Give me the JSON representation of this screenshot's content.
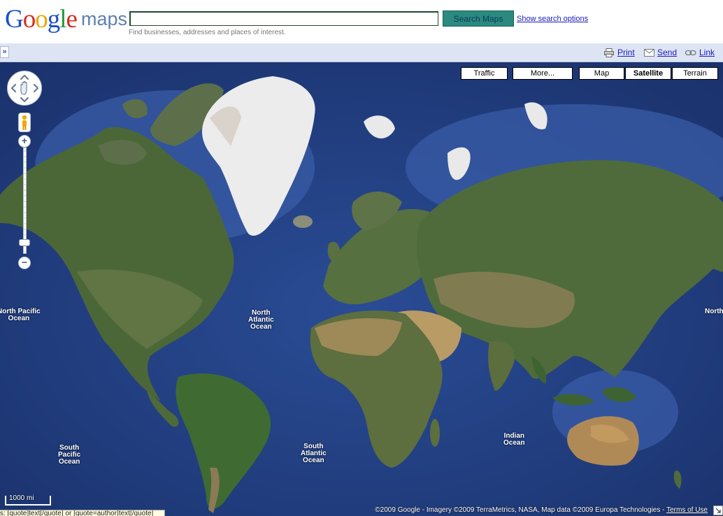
{
  "header": {
    "logo_google": "Google",
    "logo_maps": "maps",
    "search_value": "",
    "search_button": "Search Maps",
    "search_options": "Show search options",
    "search_hint": "Find businesses, addresses and places of interest."
  },
  "toolbar": {
    "expand": "»",
    "print": "Print",
    "send": "Send",
    "link": "Link"
  },
  "map": {
    "types": {
      "traffic": "Traffic",
      "more": "More...",
      "map": "Map",
      "satellite": "Satellite",
      "terrain": "Terrain"
    },
    "active_type": "Satellite",
    "zoom_in": "+",
    "zoom_out": "−",
    "zoom_level_fraction": 0.1,
    "oceans": {
      "north_pacific_w": "North Pacific\nOcean",
      "north_atlantic": "North\nAtlantic\nOcean",
      "south_pacific": "South\nPacific\nOcean",
      "south_atlantic": "South\nAtlantic\nOcean",
      "indian": "Indian\nOcean",
      "north_pacific_e": "North"
    },
    "scale": "1000 mi",
    "copyright": "©2009 Google - Imagery ©2009 TerraMetrics, NASA, Map data ©2009 Europa Technologies -",
    "terms": "Terms of Use",
    "status": "s: [quote]text[/quote] or [quote=author]text[/quote]"
  },
  "colors": {
    "ocean_deep": "#1d3a7a",
    "ocean_shallow": "#3f63a8",
    "land": "#4e6a3a",
    "desert": "#b59a66",
    "ice": "#eeeeee",
    "toolbar_bg": "#dde5f4",
    "search_button_bg": "#2a8a80"
  },
  "icons": [
    "print-icon",
    "envelope-icon",
    "link-icon",
    "pan-arrows-icon",
    "hand-icon",
    "pegman-icon",
    "expand-icon"
  ]
}
